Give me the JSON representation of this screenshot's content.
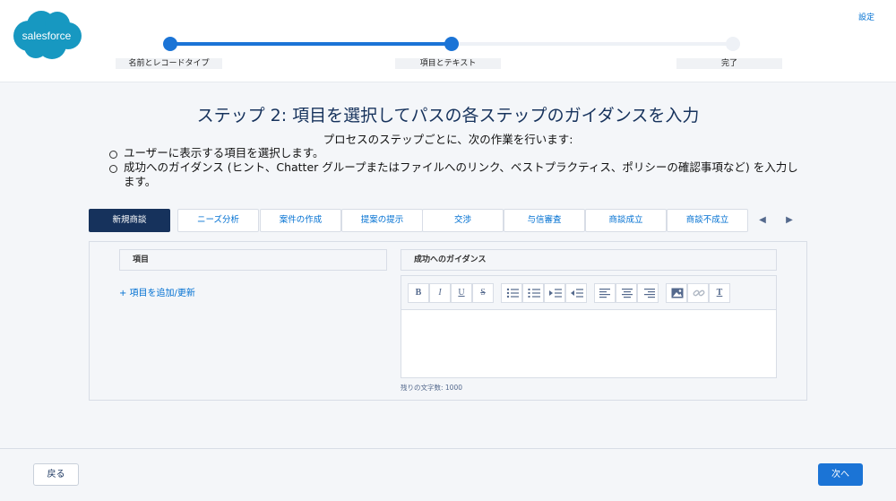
{
  "header": {
    "logo_text": "salesforce",
    "settings_label": "設定",
    "path_steps": [
      {
        "label": "名前とレコードタイプ",
        "state": "done"
      },
      {
        "label": "項目とテキスト",
        "state": "current"
      },
      {
        "label": "完了",
        "state": "todo"
      }
    ]
  },
  "main": {
    "title": "ステップ 2: 項目を選択してパスの各ステップのガイダンスを入力",
    "intro": "プロセスのステップごとに、次の作業を行います:",
    "tasks": [
      "ユーザーに表示する項目を選択します。",
      "成功へのガイダンス (ヒント、Chatter グループまたはファイルへのリンク、ベストプラクティス、ポリシーの確認事項など) を入力します。"
    ],
    "tabs": [
      "新規商談",
      "ニーズ分析",
      "案件の作成",
      "提案の提示",
      "交渉",
      "与信審査",
      "商談成立",
      "商談不成立"
    ],
    "fields_header": "項目",
    "add_field_link": "+ 項目を追加/更新",
    "guidance_header": "成功へのガイダンス",
    "char_count": "残りの文字数: 1000",
    "toolbar": {
      "bold": "B",
      "italic": "I",
      "underline": "U",
      "strike": "S",
      "clear": "T"
    }
  },
  "footer": {
    "back_label": "戻る",
    "next_label": "次へ"
  },
  "colors": {
    "brand_blue": "#1b74d6",
    "logo_blue": "#1798c1",
    "active_tab": "#16325c",
    "link": "#0070d2"
  }
}
